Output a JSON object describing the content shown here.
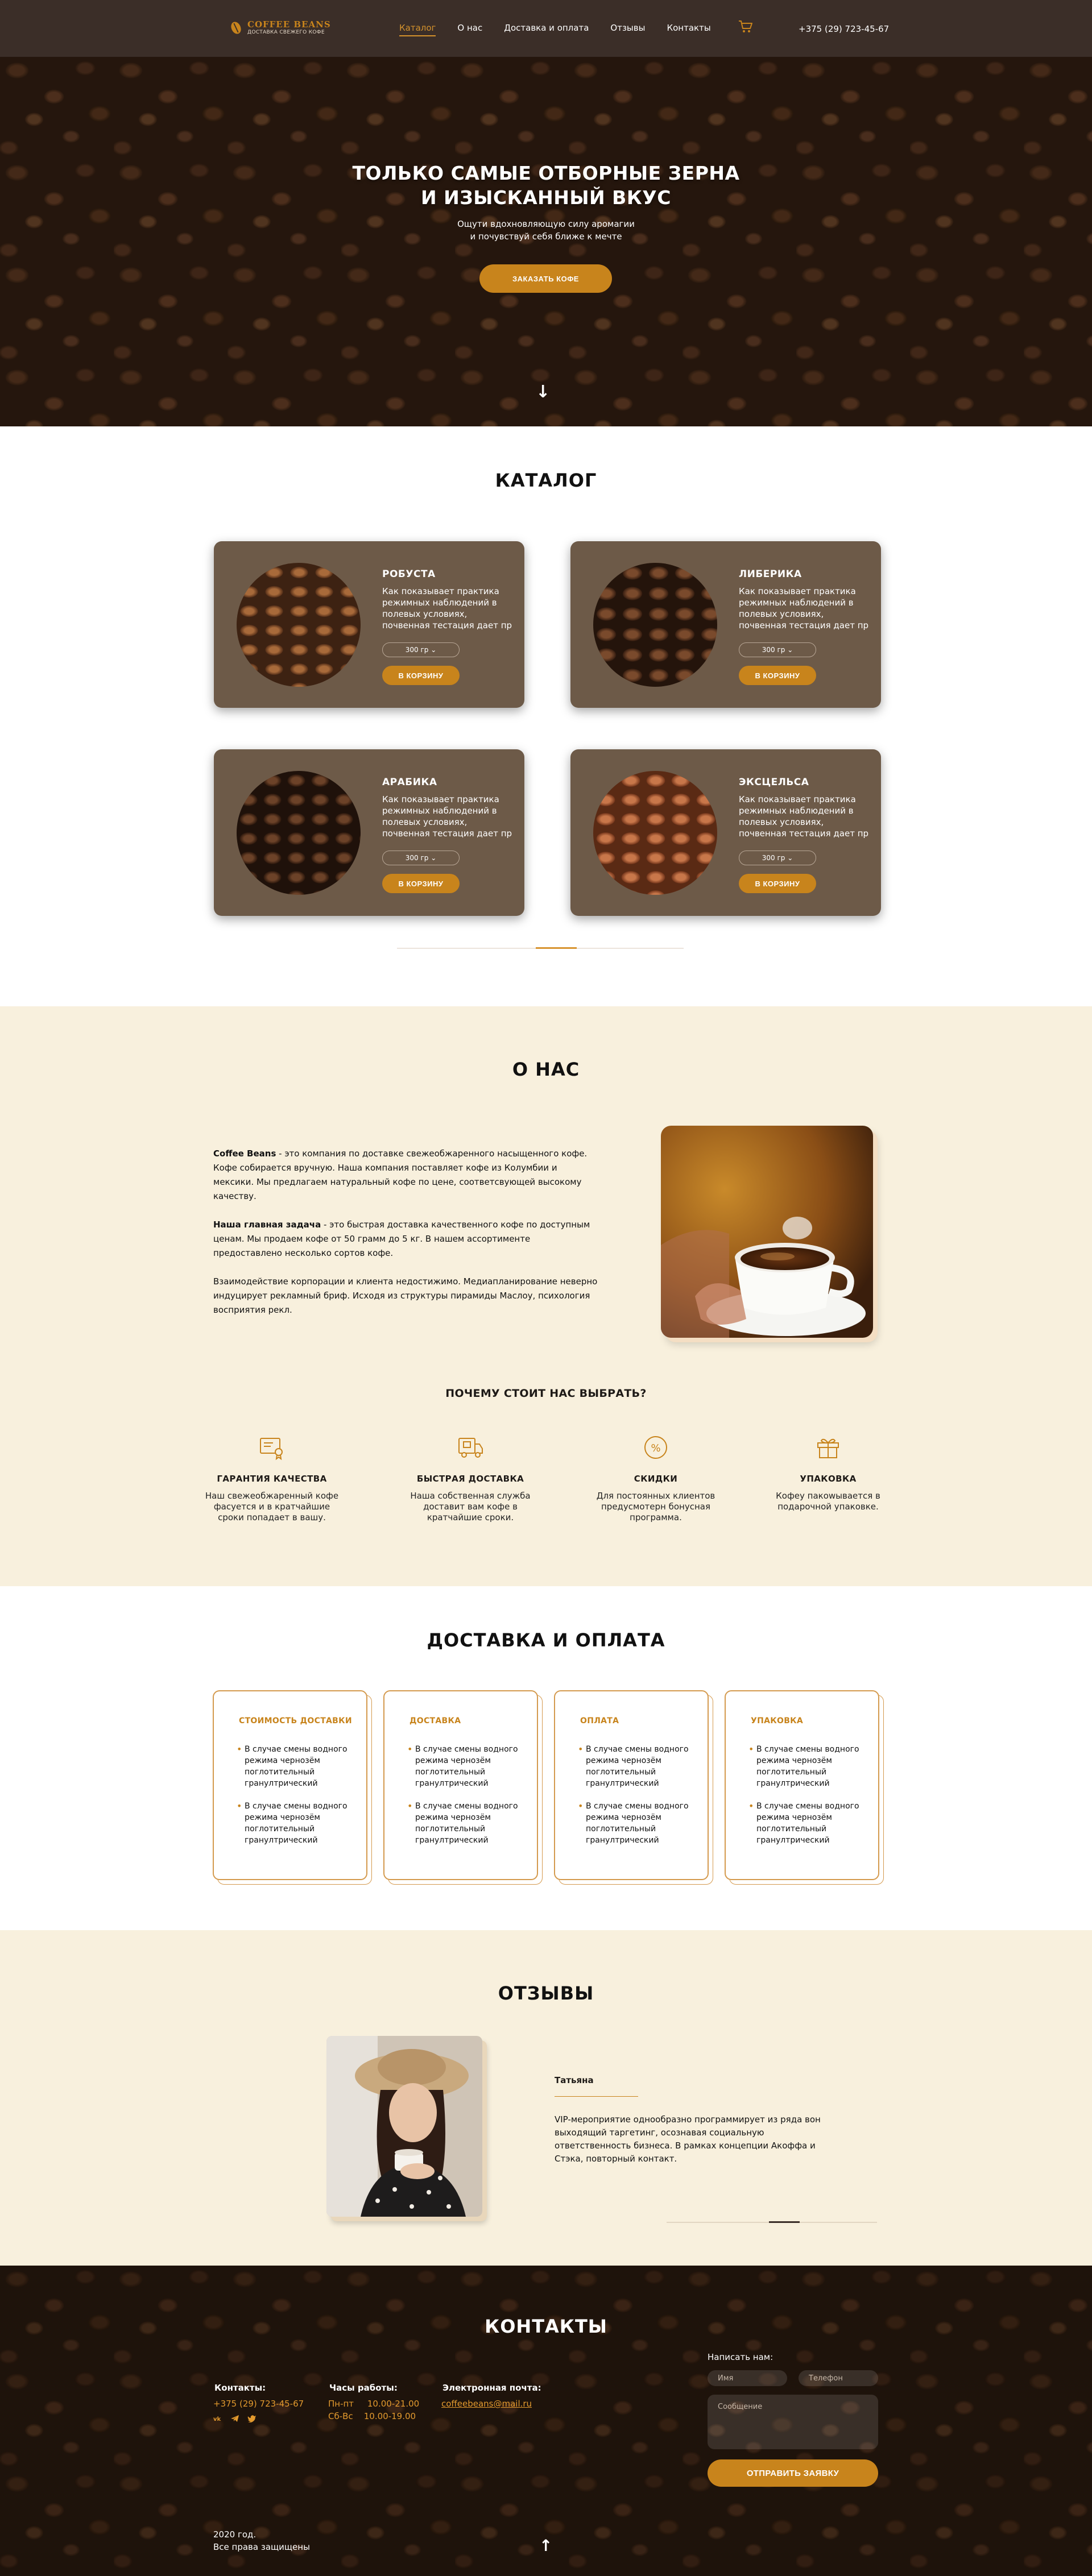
{
  "header": {
    "logo_title": "COFFEE BEANS",
    "logo_tagline": "ДОСТАВКА СВЕЖЕГО КОФЕ",
    "nav": [
      {
        "label": "Каталог",
        "active": true
      },
      {
        "label": "О нас",
        "active": false
      },
      {
        "label": "Доставка и оплата",
        "active": false
      },
      {
        "label": "Отзывы",
        "active": false
      },
      {
        "label": "Контакты",
        "active": false
      }
    ],
    "cart_icon": "shopping-cart-icon",
    "phone": "+375 (29) 723-45-67"
  },
  "hero": {
    "title_line1": "ТОЛЬКО САМЫЕ ОТБОРНЫЕ ЗЕРНА",
    "title_line2": "И ИЗЫСКАННЫЙ ВКУС",
    "subtitle_line1": "Ощути вдохновляющую силу аромагии",
    "subtitle_line2": "и почувствуй себя ближе к мечте",
    "cta_label": "ЗАКАЗАТЬ КОФЕ",
    "scroll_icon": "arrow-down-icon"
  },
  "catalog": {
    "title": "КАТАЛОГ",
    "products": [
      {
        "name": "РОБУСТА",
        "description": "Как показывает практика режимных наблюдений в полевых условиях, почвенная тестация дает пр",
        "weight": "300 гр ⌄",
        "button": "В КОРЗИНУ",
        "bean_color": "#7a4520"
      },
      {
        "name": "ЛИБЕРИКА",
        "description": "Как показывает практика режимных наблюдений в полевых условиях, почвенная тестация дает пр",
        "weight": "300 гр ⌄",
        "button": "В КОРЗИНУ",
        "bean_color": "#5a3420"
      },
      {
        "name": "АРАБИКА",
        "description": "Как показывает практика режимных наблюдений в полевых условиях, почвенная тестация дает пр",
        "weight": "300 гр ⌄",
        "button": "В КОРЗИНУ",
        "bean_color": "#4a2c1c"
      },
      {
        "name": "ЭКСЦЕЛЬСА",
        "description": "Как показывает практика режимных наблюдений в полевых условиях, почвенная тестация дает пр",
        "weight": "300 гр ⌄",
        "button": "В КОРЗИНУ",
        "bean_color": "#8a4a2a"
      }
    ]
  },
  "about": {
    "title": "О НАС",
    "p1_bold": "Coffee Beans",
    "p1_text": " - это компания по доставке свежеобжаренного насыщенного кофе. Кофе собирается вручную. Наша компания поставляет кофе из Колумбии и мексики. Мы предлагаем натуральный кофе по цене, соответсвующей высокому качеству.",
    "p2_bold": "Наша главная задача",
    "p2_text": " - это быстрая доставка качественного кофе по доступным ценам. Мы продаем кофе от 50 грамм до 5 кг. В нашем ассортименте предоставлено несколько сортов кофе.",
    "p3_text": "Взаимодействие корпорации и клиента недостижимо. Медиапланирование неверно индуцирует рекламный бриф. Исходя из структуры пирамиды Маслоу, психология восприятия рекл.",
    "why_title": "ПОЧЕМУ СТОИТ НАС ВЫБРАТЬ?",
    "features": [
      {
        "icon": "certificate-icon",
        "title": "ГАРАНТИЯ КАЧЕСТВА",
        "text": "Наш свежеобжаренный кофе фасуется и в кратчайшие сроки попадает в вашу."
      },
      {
        "icon": "delivery-truck-icon",
        "title": "БЫСТРАЯ ДОСТАВКА",
        "text": "Наша  собственная служба доставит вам кофе в кратчайшие сроки."
      },
      {
        "icon": "discount-icon",
        "title": "СКИДКИ",
        "text": "Для постоянных клиентов предусмотерн бонусная программа."
      },
      {
        "icon": "gift-box-icon",
        "title": "УПАКОВКА",
        "text": "Кофеу пакowывается в подарочной упаковке."
      }
    ]
  },
  "delivery": {
    "title": "ДОСТАВКА И ОПЛАТА",
    "cards": [
      {
        "title": "СТОИМОСТЬ ДОСТАВКИ",
        "items": [
          "В случае смены водного режима чернозём поглотительный гранултрический",
          "В случае смены водного режима чернозём поглотительный гранултрический"
        ]
      },
      {
        "title": "ДОСТАВКА",
        "items": [
          "В случае смены водного режима чернозём поглотительный гранултрический",
          "В случае смены водного режима чернозём поглотительный гранултрический"
        ]
      },
      {
        "title": "ОПЛАТА",
        "items": [
          "В случае смены водного режима чернозём поглотительный гранултрический",
          "В случае смены водного режима чернозём поглотительный гранултрический"
        ]
      },
      {
        "title": "УПАКОВКА",
        "items": [
          "В случае смены водного режима чернозём поглотительный гранултрический",
          "В случае смены водного режима чернозём поглотительный гранултрический"
        ]
      }
    ]
  },
  "reviews": {
    "title": "ОТЗЫВЫ",
    "name": "Татьяна",
    "text": "VIP-мероприятие однообразно программирует из ряда вон выходящий таргетинг, осознавая социальную ответственность бизнеса. В рамках концепции Акоффа и Стэка, повторный контакт."
  },
  "contacts": {
    "title": "КОНТАКТЫ",
    "phone_heading": "Контакты:",
    "phone": "+375 (29) 723-45-67",
    "hours_heading": "Часы работы:",
    "hours_line1_days": "Пн-пт",
    "hours_line1_time": "10.00-21.00",
    "hours_line2_days": "Сб-Вс",
    "hours_line2_time": "10.00-19.00",
    "email_heading": "Электронная почта:",
    "email": "coffeebeans@mail.ru",
    "social_icons": [
      "vk-icon",
      "telegram-icon",
      "twitter-icon"
    ],
    "form_heading": "Написать нам:",
    "name_placeholder": "Имя",
    "phone_placeholder": "Телефон",
    "message_placeholder": "Сообщение",
    "submit_label": "ОТПРАВИТЬ ЗАЯВКУ",
    "copyright_line1": "2020 год.",
    "copyright_line2": "Все права защищены",
    "scroll_top_icon": "arrow-up-icon"
  },
  "colors": {
    "accent": "#c8841c",
    "header_bg": "#3b2e28",
    "card_bg": "#6d5a48",
    "cream_bg": "#f8f0dd"
  }
}
